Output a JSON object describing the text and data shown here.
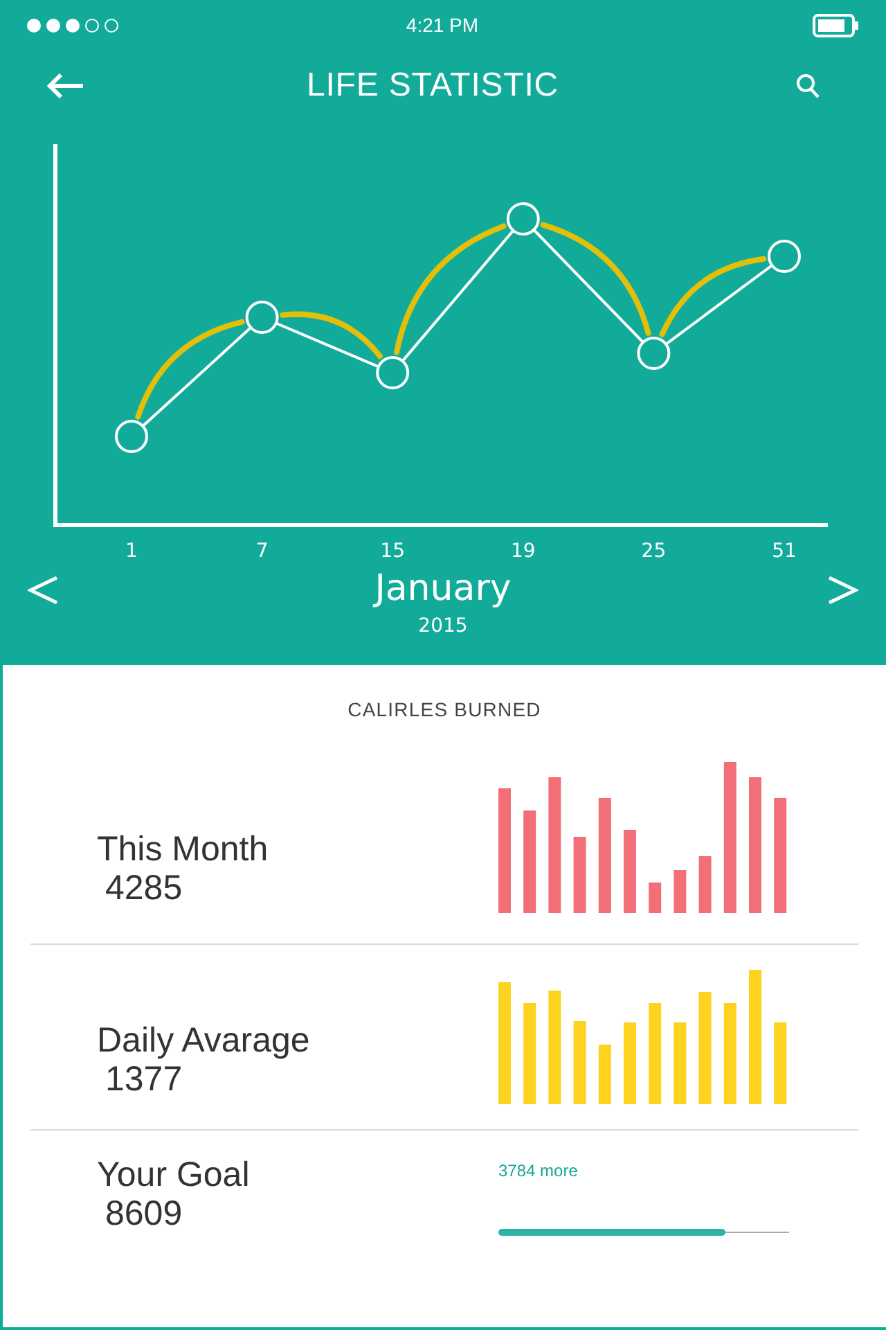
{
  "status_bar": {
    "time": "4:21 PM"
  },
  "header": {
    "title": "LIFE STATISTIC"
  },
  "chart": {
    "x_labels": [
      "1",
      "7",
      "15",
      "19",
      "25",
      "51"
    ]
  },
  "period": {
    "month": "January",
    "year": "2015"
  },
  "calories": {
    "title": "CALIRLES BURNED",
    "rows": [
      {
        "kind": "bars",
        "label": "This Month",
        "value": "4285",
        "color": "#f36f78"
      },
      {
        "kind": "bars",
        "label": "Daily Avarage",
        "value": "1377",
        "color": "#fdd320"
      },
      {
        "kind": "progress",
        "label": "Your Goal",
        "value": "8609",
        "note": "3784 more",
        "level": 0.78
      }
    ]
  }
}
